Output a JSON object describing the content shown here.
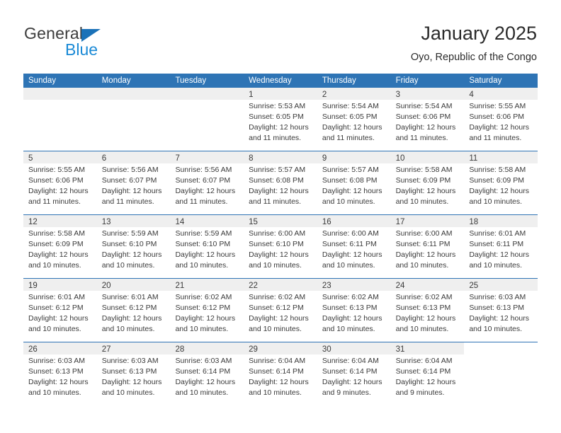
{
  "brand": {
    "word_general": "General",
    "word_blue": "Blue",
    "triangle_color": "#1b72b8",
    "blue_color": "#1b8ad6"
  },
  "header": {
    "title": "January 2025",
    "subtitle": "Oyo, Republic of the Congo"
  },
  "colors": {
    "header_blue": "#2e74b5",
    "daynum_strip": "#efefef",
    "text": "#3a3a3a"
  },
  "calendar": {
    "weekday_headers": [
      "Sunday",
      "Monday",
      "Tuesday",
      "Wednesday",
      "Thursday",
      "Friday",
      "Saturday"
    ],
    "labels": {
      "sunrise": "Sunrise:",
      "sunset": "Sunset:",
      "daylight": "Daylight:"
    },
    "weeks": [
      [
        {
          "day": "",
          "empty": true
        },
        {
          "day": "",
          "empty": true
        },
        {
          "day": "",
          "empty": true
        },
        {
          "day": "1",
          "sunrise": "Sunrise: 5:53 AM",
          "sunset": "Sunset: 6:05 PM",
          "daylight1": "Daylight: 12 hours",
          "daylight2": "and 11 minutes."
        },
        {
          "day": "2",
          "sunrise": "Sunrise: 5:54 AM",
          "sunset": "Sunset: 6:05 PM",
          "daylight1": "Daylight: 12 hours",
          "daylight2": "and 11 minutes."
        },
        {
          "day": "3",
          "sunrise": "Sunrise: 5:54 AM",
          "sunset": "Sunset: 6:06 PM",
          "daylight1": "Daylight: 12 hours",
          "daylight2": "and 11 minutes."
        },
        {
          "day": "4",
          "sunrise": "Sunrise: 5:55 AM",
          "sunset": "Sunset: 6:06 PM",
          "daylight1": "Daylight: 12 hours",
          "daylight2": "and 11 minutes."
        }
      ],
      [
        {
          "day": "5",
          "sunrise": "Sunrise: 5:55 AM",
          "sunset": "Sunset: 6:06 PM",
          "daylight1": "Daylight: 12 hours",
          "daylight2": "and 11 minutes."
        },
        {
          "day": "6",
          "sunrise": "Sunrise: 5:56 AM",
          "sunset": "Sunset: 6:07 PM",
          "daylight1": "Daylight: 12 hours",
          "daylight2": "and 11 minutes."
        },
        {
          "day": "7",
          "sunrise": "Sunrise: 5:56 AM",
          "sunset": "Sunset: 6:07 PM",
          "daylight1": "Daylight: 12 hours",
          "daylight2": "and 11 minutes."
        },
        {
          "day": "8",
          "sunrise": "Sunrise: 5:57 AM",
          "sunset": "Sunset: 6:08 PM",
          "daylight1": "Daylight: 12 hours",
          "daylight2": "and 11 minutes."
        },
        {
          "day": "9",
          "sunrise": "Sunrise: 5:57 AM",
          "sunset": "Sunset: 6:08 PM",
          "daylight1": "Daylight: 12 hours",
          "daylight2": "and 10 minutes."
        },
        {
          "day": "10",
          "sunrise": "Sunrise: 5:58 AM",
          "sunset": "Sunset: 6:09 PM",
          "daylight1": "Daylight: 12 hours",
          "daylight2": "and 10 minutes."
        },
        {
          "day": "11",
          "sunrise": "Sunrise: 5:58 AM",
          "sunset": "Sunset: 6:09 PM",
          "daylight1": "Daylight: 12 hours",
          "daylight2": "and 10 minutes."
        }
      ],
      [
        {
          "day": "12",
          "sunrise": "Sunrise: 5:58 AM",
          "sunset": "Sunset: 6:09 PM",
          "daylight1": "Daylight: 12 hours",
          "daylight2": "and 10 minutes."
        },
        {
          "day": "13",
          "sunrise": "Sunrise: 5:59 AM",
          "sunset": "Sunset: 6:10 PM",
          "daylight1": "Daylight: 12 hours",
          "daylight2": "and 10 minutes."
        },
        {
          "day": "14",
          "sunrise": "Sunrise: 5:59 AM",
          "sunset": "Sunset: 6:10 PM",
          "daylight1": "Daylight: 12 hours",
          "daylight2": "and 10 minutes."
        },
        {
          "day": "15",
          "sunrise": "Sunrise: 6:00 AM",
          "sunset": "Sunset: 6:10 PM",
          "daylight1": "Daylight: 12 hours",
          "daylight2": "and 10 minutes."
        },
        {
          "day": "16",
          "sunrise": "Sunrise: 6:00 AM",
          "sunset": "Sunset: 6:11 PM",
          "daylight1": "Daylight: 12 hours",
          "daylight2": "and 10 minutes."
        },
        {
          "day": "17",
          "sunrise": "Sunrise: 6:00 AM",
          "sunset": "Sunset: 6:11 PM",
          "daylight1": "Daylight: 12 hours",
          "daylight2": "and 10 minutes."
        },
        {
          "day": "18",
          "sunrise": "Sunrise: 6:01 AM",
          "sunset": "Sunset: 6:11 PM",
          "daylight1": "Daylight: 12 hours",
          "daylight2": "and 10 minutes."
        }
      ],
      [
        {
          "day": "19",
          "sunrise": "Sunrise: 6:01 AM",
          "sunset": "Sunset: 6:12 PM",
          "daylight1": "Daylight: 12 hours",
          "daylight2": "and 10 minutes."
        },
        {
          "day": "20",
          "sunrise": "Sunrise: 6:01 AM",
          "sunset": "Sunset: 6:12 PM",
          "daylight1": "Daylight: 12 hours",
          "daylight2": "and 10 minutes."
        },
        {
          "day": "21",
          "sunrise": "Sunrise: 6:02 AM",
          "sunset": "Sunset: 6:12 PM",
          "daylight1": "Daylight: 12 hours",
          "daylight2": "and 10 minutes."
        },
        {
          "day": "22",
          "sunrise": "Sunrise: 6:02 AM",
          "sunset": "Sunset: 6:12 PM",
          "daylight1": "Daylight: 12 hours",
          "daylight2": "and 10 minutes."
        },
        {
          "day": "23",
          "sunrise": "Sunrise: 6:02 AM",
          "sunset": "Sunset: 6:13 PM",
          "daylight1": "Daylight: 12 hours",
          "daylight2": "and 10 minutes."
        },
        {
          "day": "24",
          "sunrise": "Sunrise: 6:02 AM",
          "sunset": "Sunset: 6:13 PM",
          "daylight1": "Daylight: 12 hours",
          "daylight2": "and 10 minutes."
        },
        {
          "day": "25",
          "sunrise": "Sunrise: 6:03 AM",
          "sunset": "Sunset: 6:13 PM",
          "daylight1": "Daylight: 12 hours",
          "daylight2": "and 10 minutes."
        }
      ],
      [
        {
          "day": "26",
          "sunrise": "Sunrise: 6:03 AM",
          "sunset": "Sunset: 6:13 PM",
          "daylight1": "Daylight: 12 hours",
          "daylight2": "and 10 minutes."
        },
        {
          "day": "27",
          "sunrise": "Sunrise: 6:03 AM",
          "sunset": "Sunset: 6:13 PM",
          "daylight1": "Daylight: 12 hours",
          "daylight2": "and 10 minutes."
        },
        {
          "day": "28",
          "sunrise": "Sunrise: 6:03 AM",
          "sunset": "Sunset: 6:14 PM",
          "daylight1": "Daylight: 12 hours",
          "daylight2": "and 10 minutes."
        },
        {
          "day": "29",
          "sunrise": "Sunrise: 6:04 AM",
          "sunset": "Sunset: 6:14 PM",
          "daylight1": "Daylight: 12 hours",
          "daylight2": "and 10 minutes."
        },
        {
          "day": "30",
          "sunrise": "Sunrise: 6:04 AM",
          "sunset": "Sunset: 6:14 PM",
          "daylight1": "Daylight: 12 hours",
          "daylight2": "and 9 minutes."
        },
        {
          "day": "31",
          "sunrise": "Sunrise: 6:04 AM",
          "sunset": "Sunset: 6:14 PM",
          "daylight1": "Daylight: 12 hours",
          "daylight2": "and 9 minutes."
        },
        {
          "day": "",
          "empty": true,
          "no_strip": true
        }
      ]
    ]
  }
}
